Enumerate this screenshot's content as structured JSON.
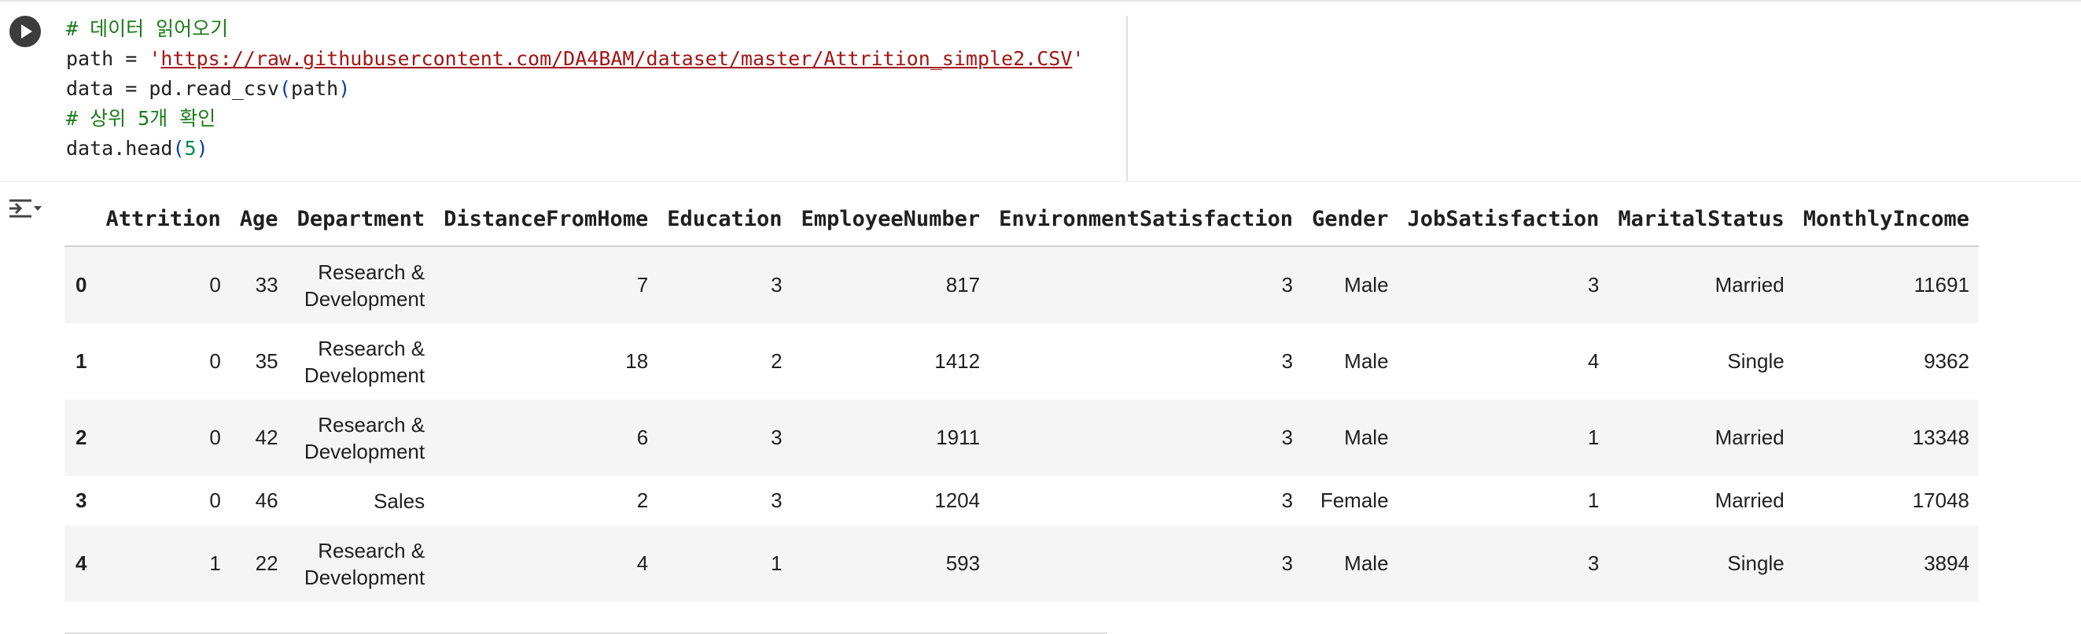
{
  "code_cell": {
    "lines": [
      {
        "type": "comment",
        "text": "# 데이터 읽어오기"
      },
      {
        "type": "assign_string",
        "pre": "path = ",
        "quote": "'",
        "url": "https://raw.githubusercontent.com/DA4BAM/dataset/master/Attrition_simple2.CSV"
      },
      {
        "type": "call",
        "pre": "data = pd.read_csv",
        "open": "(",
        "arg": "path",
        "close": ")"
      },
      {
        "type": "comment",
        "text": "# 상위 5개 확인"
      },
      {
        "type": "call_num",
        "pre": "data.head",
        "open": "(",
        "arg": "5",
        "close": ")"
      }
    ]
  },
  "icons": {
    "run": "play-icon",
    "output": "output-options-icon"
  },
  "dataframe": {
    "columns": [
      "",
      "Attrition",
      "Age",
      "Department",
      "DistanceFromHome",
      "Education",
      "EmployeeNumber",
      "EnvironmentSatisfaction",
      "Gender",
      "JobSatisfaction",
      "MaritalStatus",
      "MonthlyIncome"
    ],
    "rows": [
      [
        "0",
        "0",
        "33",
        "Research & Development",
        "7",
        "3",
        "817",
        "3",
        "Male",
        "3",
        "Married",
        "11691"
      ],
      [
        "1",
        "0",
        "35",
        "Research & Development",
        "18",
        "2",
        "1412",
        "3",
        "Male",
        "4",
        "Single",
        "9362"
      ],
      [
        "2",
        "0",
        "42",
        "Research & Development",
        "6",
        "3",
        "1911",
        "3",
        "Male",
        "1",
        "Married",
        "13348"
      ],
      [
        "3",
        "0",
        "46",
        "Sales",
        "2",
        "3",
        "1204",
        "3",
        "Female",
        "1",
        "Married",
        "17048"
      ],
      [
        "4",
        "1",
        "22",
        "Research & Development",
        "4",
        "1",
        "593",
        "3",
        "Male",
        "3",
        "Single",
        "3894"
      ]
    ]
  },
  "colors": {
    "comment": "#1b7d1b",
    "string": "#a31515",
    "paren": "#0b3da8",
    "number": "#098658",
    "row_stripe": "#f5f5f5"
  }
}
